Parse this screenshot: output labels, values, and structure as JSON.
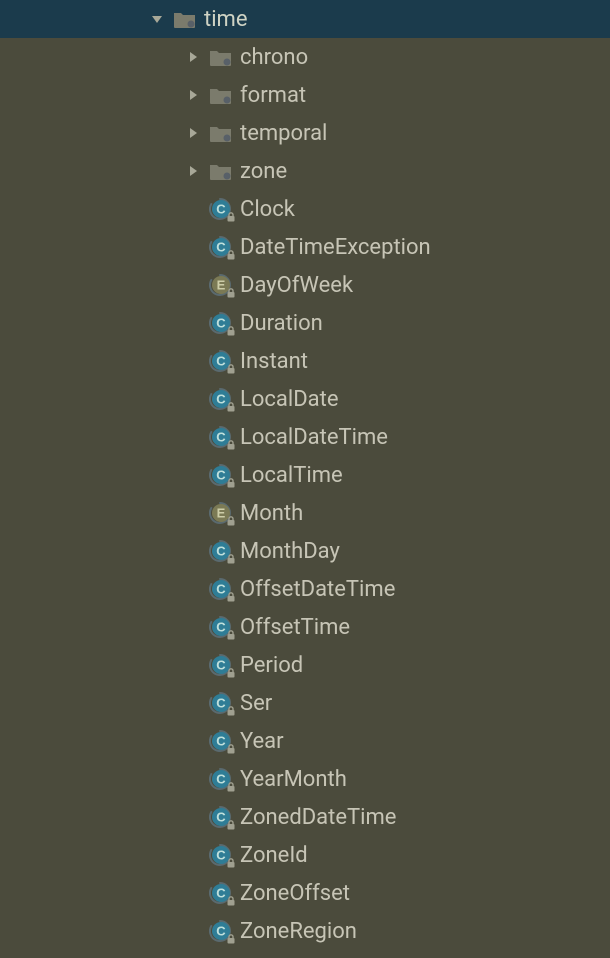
{
  "tree": {
    "root": {
      "label": "time",
      "type": "package",
      "expanded": true,
      "selected": true,
      "children": {
        "packages": [
          {
            "label": "chrono",
            "type": "package",
            "expanded": false
          },
          {
            "label": "format",
            "type": "package",
            "expanded": false
          },
          {
            "label": "temporal",
            "type": "package",
            "expanded": false
          },
          {
            "label": "zone",
            "type": "package",
            "expanded": false
          }
        ],
        "classes": [
          {
            "label": "Clock",
            "type": "class",
            "locked": true
          },
          {
            "label": "DateTimeException",
            "type": "class",
            "locked": true
          },
          {
            "label": "DayOfWeek",
            "type": "enum",
            "locked": true
          },
          {
            "label": "Duration",
            "type": "class",
            "locked": true
          },
          {
            "label": "Instant",
            "type": "class",
            "locked": true
          },
          {
            "label": "LocalDate",
            "type": "class",
            "locked": true
          },
          {
            "label": "LocalDateTime",
            "type": "class",
            "locked": true
          },
          {
            "label": "LocalTime",
            "type": "class",
            "locked": true
          },
          {
            "label": "Month",
            "type": "enum",
            "locked": true
          },
          {
            "label": "MonthDay",
            "type": "class",
            "locked": true
          },
          {
            "label": "OffsetDateTime",
            "type": "class",
            "locked": true
          },
          {
            "label": "OffsetTime",
            "type": "class",
            "locked": true
          },
          {
            "label": "Period",
            "type": "class",
            "locked": true
          },
          {
            "label": "Ser",
            "type": "class",
            "locked": true
          },
          {
            "label": "Year",
            "type": "class",
            "locked": true
          },
          {
            "label": "YearMonth",
            "type": "class",
            "locked": true
          },
          {
            "label": "ZonedDateTime",
            "type": "class",
            "locked": true
          },
          {
            "label": "ZoneId",
            "type": "class",
            "locked": true
          },
          {
            "label": "ZoneOffset",
            "type": "class",
            "locked": true
          },
          {
            "label": "ZoneRegion",
            "type": "class",
            "locked": true
          }
        ]
      }
    }
  },
  "colors": {
    "bg": "#4b4b3c",
    "selected_bg": "#1b3b4c",
    "text": "#c7c5b6",
    "arrow": "#a8a898",
    "package_icon": "#7f7f70",
    "class_circle": "#3d8ea8",
    "class_letter": "#b7d7d1",
    "enum_circle": "#81805c",
    "enum_letter": "#c9c9a6"
  }
}
